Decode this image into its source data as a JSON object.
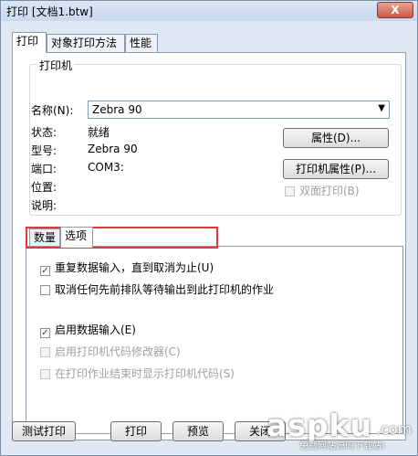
{
  "window": {
    "title": "打印 [文档1.btw]",
    "close_label": "X"
  },
  "tabs": [
    {
      "label": "打印",
      "active": true
    },
    {
      "label": "对象打印方法",
      "active": false
    },
    {
      "label": "性能",
      "active": false
    }
  ],
  "printer_group": {
    "label": "打印机",
    "name_label": "名称(N):",
    "name_value": "Zebra 90",
    "status_label": "状态:",
    "status_value": "就绪",
    "model_label": "型号:",
    "model_value": "Zebra 90",
    "port_label": "端口:",
    "port_value": "COM3:",
    "location_label": "位置:",
    "comment_label": "说明:",
    "properties_button": "属性(D)...",
    "printer_properties_button": "打印机属性(P)...",
    "duplex_label": "双面打印(B)"
  },
  "subtabs": [
    {
      "label": "数量",
      "active": false
    },
    {
      "label": "选项",
      "active": true
    }
  ],
  "options": [
    {
      "label": "重复数据输入，直到取消为止(U)",
      "checked": true,
      "enabled": true
    },
    {
      "label": "取消任何先前排队等待输出到此打印机的作业",
      "checked": false,
      "enabled": true
    },
    {
      "label": "启用数据输入(E)",
      "checked": true,
      "enabled": true
    },
    {
      "label": "启用打印机代码修改器(C)",
      "checked": false,
      "enabled": false
    },
    {
      "label": "在打印作业结束时显示打印机代码(S)",
      "checked": false,
      "enabled": false
    }
  ],
  "footer": {
    "test_print": "测试打印",
    "print": "打印",
    "preview": "预览",
    "close": "关闭"
  },
  "watermark": {
    "brand": "aspku",
    "suffix": ".com",
    "tagline": "免费网站源码下载站!"
  }
}
